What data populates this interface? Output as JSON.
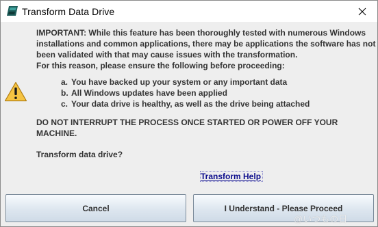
{
  "window": {
    "title": "Transform Data Drive"
  },
  "message": {
    "lines": [
      "IMPORTANT: While this feature has been thoroughly tested with numerous Windows",
      "installations and common applications, there may be applications the software has not",
      "been validated with that may cause issues with the transformation.",
      "For this reason, please ensure the following before proceeding:"
    ],
    "checklist": [
      {
        "marker": "a.",
        "text": "You have backed up your system or any important data"
      },
      {
        "marker": "b.",
        "text": "All Windows updates have been applied"
      },
      {
        "marker": "c.",
        "text": "Your data drive is healthy, as well as the drive being attached"
      }
    ],
    "warning_lines": [
      "DO NOT INTERRUPT THE PROCESS ONCE STARTED OR POWER OFF YOUR",
      "MACHINE."
    ],
    "question": "Transform data drive?"
  },
  "help_link": "Transform Help",
  "buttons": {
    "cancel": "Cancel",
    "proceed": "I Understand - Please Proceed"
  },
  "watermark": "@いつもの日",
  "icons": {
    "app": "app-drive-icon",
    "close": "close-icon",
    "warning": "warning-icon"
  },
  "colors": {
    "dialog_bg": "#eeeeee",
    "link": "#0c0c8c",
    "warning_fill": "#f5c342"
  }
}
